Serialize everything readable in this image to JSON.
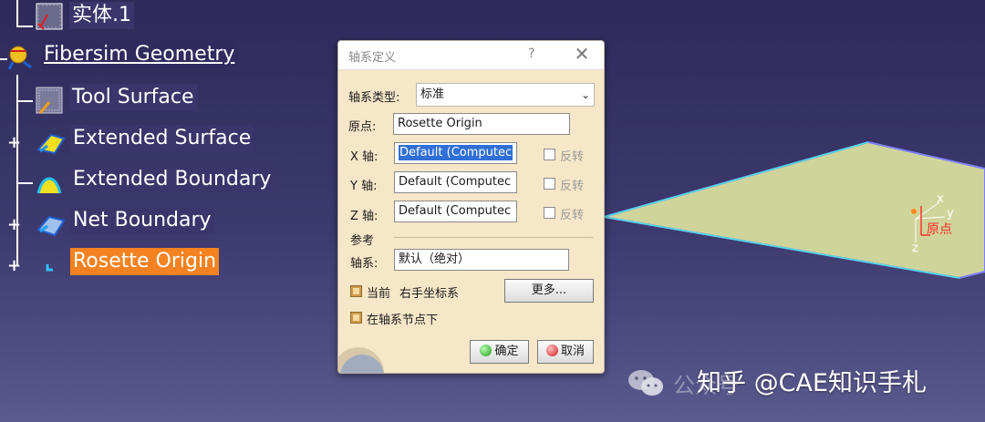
{
  "tree": {
    "items": [
      {
        "label": "实体.1"
      },
      {
        "label": "Fibersim Geometry"
      },
      {
        "label": "Tool Surface"
      },
      {
        "label": "Extended Surface"
      },
      {
        "label": "Extended Boundary"
      },
      {
        "label": "Net Boundary"
      },
      {
        "label": "Rosette Origin"
      }
    ]
  },
  "dialog": {
    "title": "轴系定义",
    "help": "?",
    "close": "✕",
    "axis_type_label": "轴系类型:",
    "axis_type_value": "标准",
    "origin_label": "原点:",
    "origin_value": "Rosette Origin",
    "x_label": "X 轴:",
    "x_value": "Default (Computec",
    "y_label": "Y 轴:",
    "y_value": "Default (Computec",
    "z_label": "Z 轴:",
    "z_value": "Default (Computec",
    "reverse_label": "反转",
    "reference_label": "参考",
    "axis_system_label": "轴系:",
    "axis_system_value": "默认（绝对）",
    "current_label": "当前",
    "right_hand_label": "右手坐标系",
    "more_button": "更多...",
    "under_node_label": "在轴系节点下",
    "ok_button": "确定",
    "cancel_button": "取消"
  },
  "scene": {
    "axis_x": "x",
    "axis_y": "y",
    "axis_z": "z",
    "origin_label": "原点"
  },
  "watermark": {
    "text": "知乎 @CAE知识手札",
    "faded": "公众号"
  },
  "colors": {
    "background": "#3c3a6e",
    "selection": "#f58220",
    "surface": "#cfd59a",
    "dialog": "#f7e7c9"
  }
}
